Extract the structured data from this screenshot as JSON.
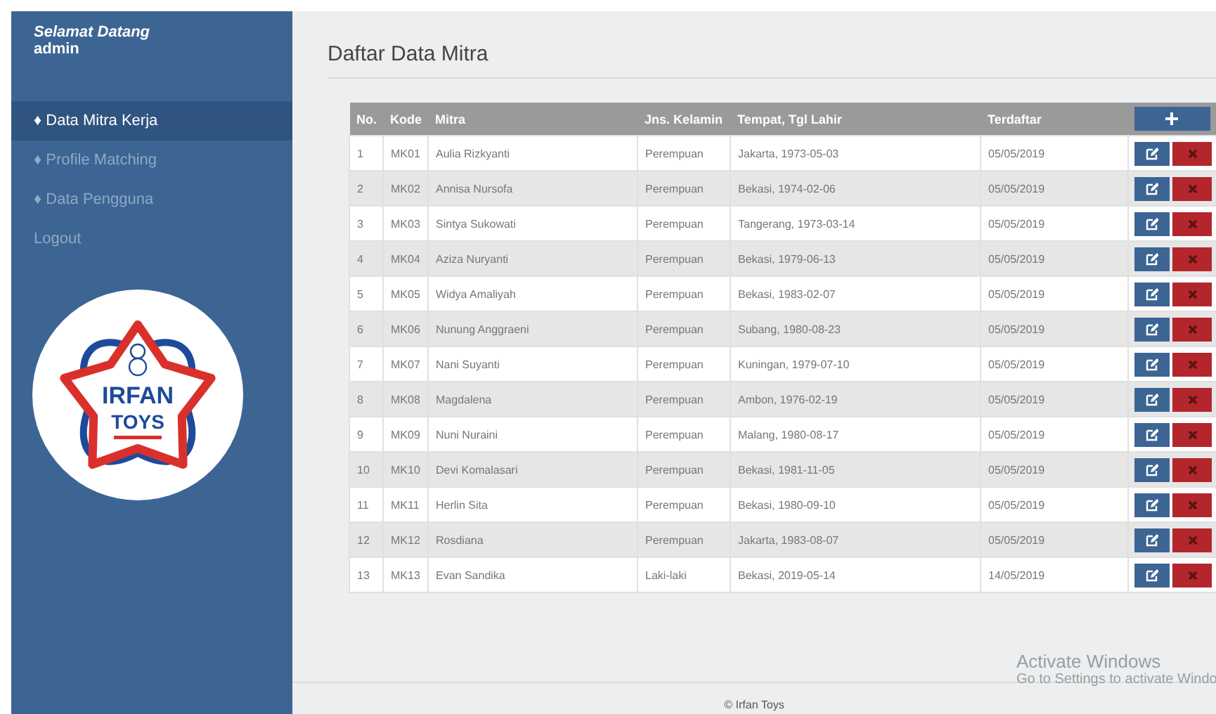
{
  "sidebar": {
    "greeting": "Selamat Datang",
    "user": "admin",
    "items": [
      {
        "label": "♦ Data Mitra Kerja",
        "selected": true
      },
      {
        "label": "♦ Profile Matching",
        "selected": false
      },
      {
        "label": "♦ Data Pengguna",
        "selected": false
      },
      {
        "label": "Logout",
        "selected": false
      }
    ],
    "logo": {
      "line1": "IRFAN",
      "line2": "TOYS"
    }
  },
  "page_title": "Daftar Data Mitra",
  "table": {
    "columns": [
      "No.",
      "Kode",
      "Mitra",
      "Jns. Kelamin",
      "Tempat, Tgl Lahir",
      "Terdaftar"
    ],
    "rows": [
      [
        "1",
        "MK01",
        "Aulia Rizkyanti",
        "Perempuan",
        "Jakarta, 1973-05-03",
        "05/05/2019"
      ],
      [
        "2",
        "MK02",
        "Annisa Nursofa",
        "Perempuan",
        "Bekasi, 1974-02-06",
        "05/05/2019"
      ],
      [
        "3",
        "MK03",
        "Sintya Sukowati",
        "Perempuan",
        "Tangerang, 1973-03-14",
        "05/05/2019"
      ],
      [
        "4",
        "MK04",
        "Aziza Nuryanti",
        "Perempuan",
        "Bekasi, 1979-06-13",
        "05/05/2019"
      ],
      [
        "5",
        "MK05",
        "Widya Amaliyah",
        "Perempuan",
        "Bekasi, 1983-02-07",
        "05/05/2019"
      ],
      [
        "6",
        "MK06",
        "Nunung Anggraeni",
        "Perempuan",
        "Subang, 1980-08-23",
        "05/05/2019"
      ],
      [
        "7",
        "MK07",
        "Nani Suyanti",
        "Perempuan",
        "Kuningan, 1979-07-10",
        "05/05/2019"
      ],
      [
        "8",
        "MK08",
        "Magdalena",
        "Perempuan",
        "Ambon, 1976-02-19",
        "05/05/2019"
      ],
      [
        "9",
        "MK09",
        "Nuni Nuraini",
        "Perempuan",
        "Malang, 1980-08-17",
        "05/05/2019"
      ],
      [
        "10",
        "MK10",
        "Devi Komalasari",
        "Perempuan",
        "Bekasi, 1981-11-05",
        "05/05/2019"
      ],
      [
        "11",
        "MK11",
        "Herlin Sita",
        "Perempuan",
        "Bekasi, 1980-09-10",
        "05/05/2019"
      ],
      [
        "12",
        "MK12",
        "Rosdiana",
        "Perempuan",
        "Jakarta, 1983-08-07",
        "05/05/2019"
      ],
      [
        "13",
        "MK13",
        "Evan Sandika",
        "Laki-laki",
        "Bekasi, 2019-05-14",
        "14/05/2019"
      ]
    ]
  },
  "footer": "© Irfan Toys",
  "os_overlay": {
    "title": "Activate Windows",
    "text": "Go to Settings to activate Windo"
  }
}
